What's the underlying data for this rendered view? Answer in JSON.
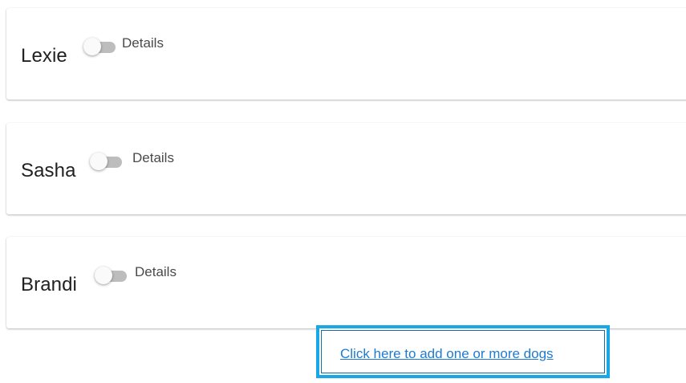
{
  "dogs": [
    {
      "name": "Lexie",
      "toggle_label": "Details",
      "toggle_on": false
    },
    {
      "name": "Sasha",
      "toggle_label": "Details",
      "toggle_on": false
    },
    {
      "name": "Brandi",
      "toggle_label": "Details",
      "toggle_on": false
    }
  ],
  "add_link": {
    "label": "Click here to add one or more dogs"
  },
  "colors": {
    "link": "#1f7bcf",
    "highlight_border": "#1aa7e6",
    "toggle_track_off": "#bdbdbd",
    "text": "#212121"
  }
}
